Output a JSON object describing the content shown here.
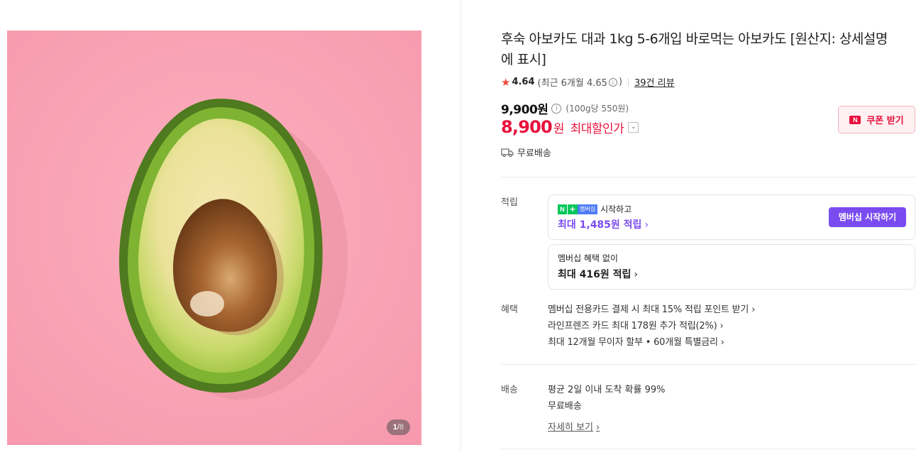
{
  "product": {
    "title": "후숙 아보카도 대과 1kg 5-6개입 바로먹는 아보카도 [원산지: 상세설명에 표시]",
    "image_pager": {
      "current": "1",
      "separator": "/",
      "total": "8"
    },
    "rating": {
      "score": "4.64",
      "recent": "(최근 6개월 4.65",
      "recent_close": ")",
      "reviews": "39건 리뷰",
      "star_color": "#f04b3a"
    },
    "price": {
      "original": "9,900원",
      "unit_price": "(100g당 550원)",
      "sale_price": "8,900",
      "sale_won": "원",
      "sale_label": "최대할인가",
      "sale_color": "#e8113d"
    },
    "coupon": {
      "icon_text": "N",
      "label": "쿠폰 받기"
    },
    "shipping_summary": "무료배송"
  },
  "points": {
    "label": "적립",
    "membership_card": {
      "badge_n": "N",
      "badge_plus": "+",
      "badge_text": "멤버십",
      "line1": "시작하고",
      "line2": "최대 1,485원 적립",
      "button": "멤버십 시작하기",
      "accent": "#7a4cf0"
    },
    "basic_card": {
      "line1": "멤버십 혜택 없이",
      "line2": "최대 416원 적립"
    }
  },
  "benefits": {
    "label": "혜택",
    "items": [
      "멤버십 전용카드 결제 시 최대 15% 적립 포인트 받기",
      "라인프렌즈 카드 최대 178원 추가 적립(2%)",
      "최대 12개월 무이자 할부 • 60개월 특별금리"
    ]
  },
  "delivery": {
    "label": "배송",
    "line1": "평균 2일 이내 도착 확률 99%",
    "line2": "무료배송",
    "detail_link": "자세히 보기"
  },
  "icons": {
    "chevron": "›",
    "info": "i",
    "dropdown": "⌄"
  }
}
